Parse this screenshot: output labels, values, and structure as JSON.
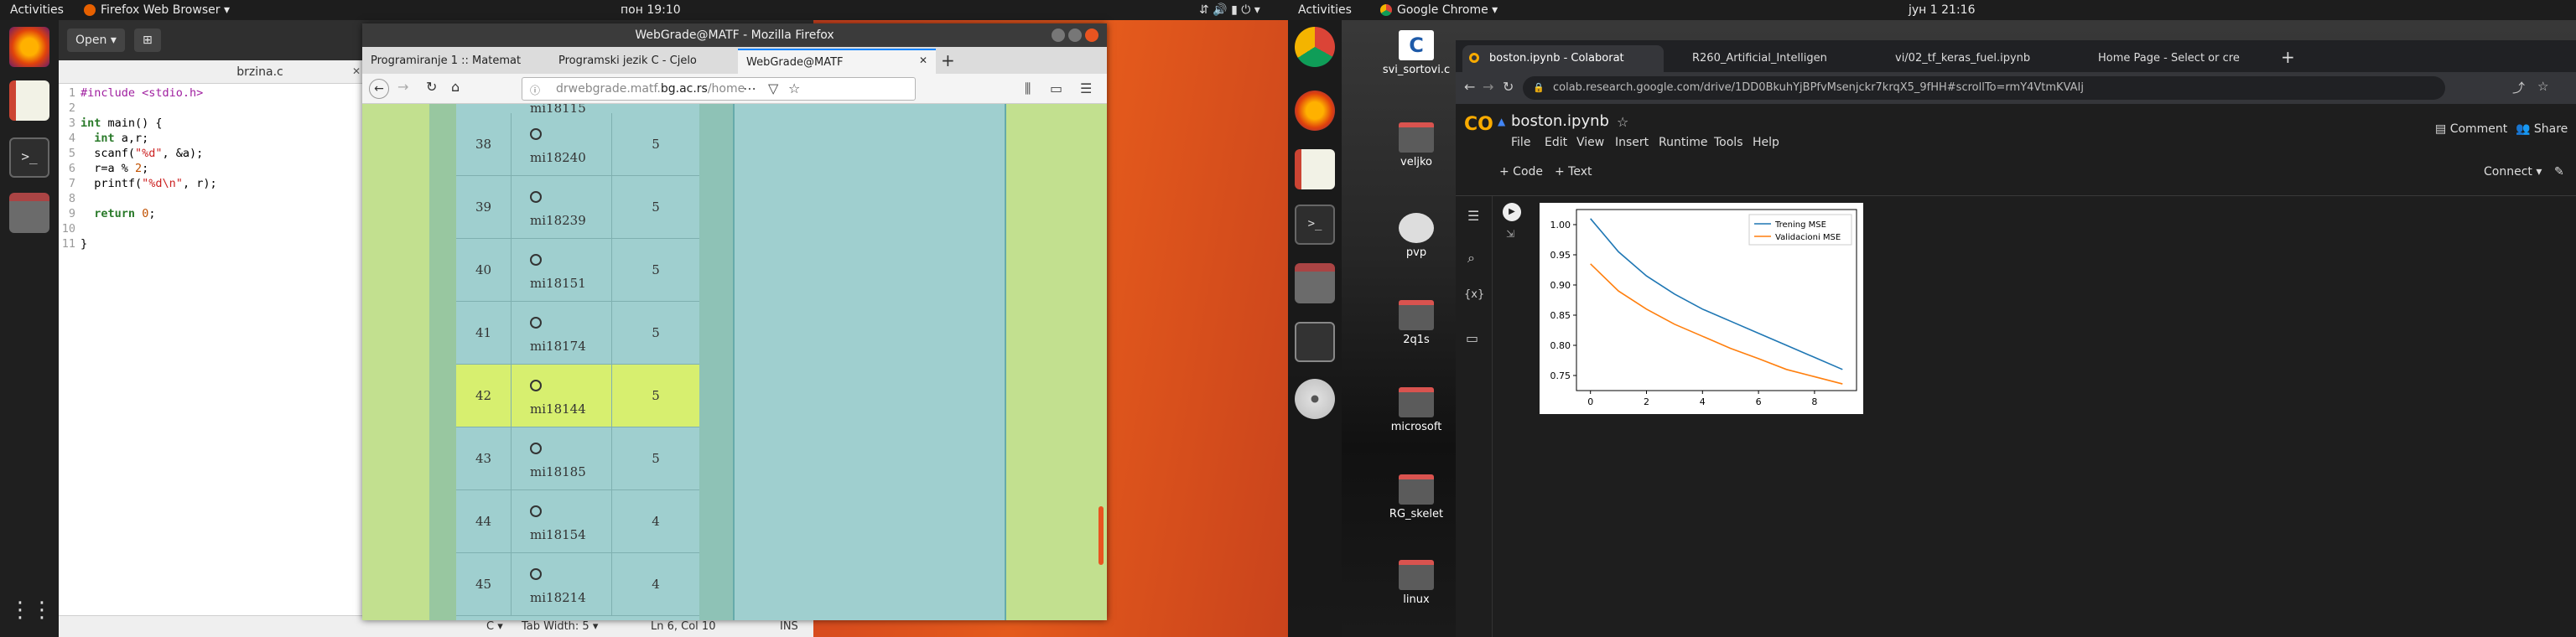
{
  "left": {
    "topbar": {
      "activities": "Activities",
      "app": "Firefox Web Browser ▾",
      "clock": "пон 19:10"
    },
    "gedit": {
      "open": "Open ▾",
      "tab_title": "brzina.c",
      "code": [
        {
          "n": "1",
          "t": "#include <stdio.h>"
        },
        {
          "n": "2",
          "t": ""
        },
        {
          "n": "3",
          "t": "int main() {"
        },
        {
          "n": "4",
          "t": "  int a,r;"
        },
        {
          "n": "5",
          "t": "  scanf(\"%d\", &a);"
        },
        {
          "n": "6",
          "t": "  r=a % 2;"
        },
        {
          "n": "7",
          "t": "  printf(\"%d\\n\", r);"
        },
        {
          "n": "8",
          "t": ""
        },
        {
          "n": "9",
          "t": "  return 0;"
        },
        {
          "n": "10",
          "t": ""
        },
        {
          "n": "11",
          "t": "}"
        }
      ],
      "status": {
        "lang": "C ▾",
        "tab": "Tab Width: 5 ▾",
        "pos": "Ln 6, Col 10",
        "mode": "INS"
      }
    },
    "firefox": {
      "title": "WebGrade@MATF - Mozilla Firefox",
      "tabs": [
        "Programiranje 1 :: Matemat",
        "Programski jezik C - Cjelo",
        "WebGrade@MATF"
      ],
      "url_prefix": "drwebgrade.matf.",
      "url_host": "bg.ac.rs",
      "url_path": "/home",
      "partial_top": "mi18115",
      "rows": [
        {
          "num": "38",
          "user": "mi18240",
          "pts": "5",
          "hl": false
        },
        {
          "num": "39",
          "user": "mi18239",
          "pts": "5",
          "hl": false
        },
        {
          "num": "40",
          "user": "mi18151",
          "pts": "5",
          "hl": false
        },
        {
          "num": "41",
          "user": "mi18174",
          "pts": "5",
          "hl": false
        },
        {
          "num": "42",
          "user": "mi18144",
          "pts": "5",
          "hl": true
        },
        {
          "num": "43",
          "user": "mi18185",
          "pts": "5",
          "hl": false
        },
        {
          "num": "44",
          "user": "mi18154",
          "pts": "4",
          "hl": false
        },
        {
          "num": "45",
          "user": "mi18214",
          "pts": "4",
          "hl": false
        }
      ]
    }
  },
  "right": {
    "topbar": {
      "activities": "Activities",
      "app": "Google Chrome ▾",
      "clock": "јун 1  21:16"
    },
    "desktop": [
      "svi_sortovi.c",
      "veljko",
      "pvp",
      "2q1s",
      "microsoft",
      "RG_skelet",
      "linux"
    ],
    "chrome": {
      "tabs": [
        "boston.ipynb - Colaborat",
        "R260_Artificial_Intelligen",
        "vi/02_tf_keras_fuel.ipynb",
        "Home Page - Select or cre"
      ],
      "url": "colab.research.google.com/drive/1DD0BkuhYjBPfvMsenjckr7krqX5_9fHH#scrollTo=rmY4VtmKVAIj"
    },
    "colab": {
      "filename": "boston.ipynb",
      "menu": [
        "File",
        "Edit",
        "View",
        "Insert",
        "Runtime",
        "Tools",
        "Help"
      ],
      "comment": "Comment",
      "share": "Share",
      "code_btn": "+ Code",
      "text_btn": "+ Text",
      "connect": "Connect ▾",
      "chart_data": {
        "type": "line",
        "x": [
          0,
          1,
          2,
          3,
          4,
          5,
          6,
          7,
          8,
          9
        ],
        "series": [
          {
            "name": "Trening MSE",
            "color": "#1f77b4",
            "values": [
              1.01,
              0.955,
              0.915,
              0.885,
              0.86,
              0.84,
              0.82,
              0.8,
              0.78,
              0.76
            ]
          },
          {
            "name": "Validacioni MSE",
            "color": "#ff7f0e",
            "values": [
              0.935,
              0.89,
              0.86,
              0.835,
              0.815,
              0.795,
              0.778,
              0.76,
              0.748,
              0.736
            ]
          }
        ],
        "xticks": [
          "0",
          "2",
          "4",
          "6",
          "8"
        ],
        "yticks": [
          "0.75",
          "0.80",
          "0.85",
          "0.90",
          "0.95",
          "1.00"
        ],
        "xlim": [
          -0.5,
          9.5
        ],
        "ylim": [
          0.725,
          1.025
        ],
        "legend": "top-right"
      }
    }
  }
}
